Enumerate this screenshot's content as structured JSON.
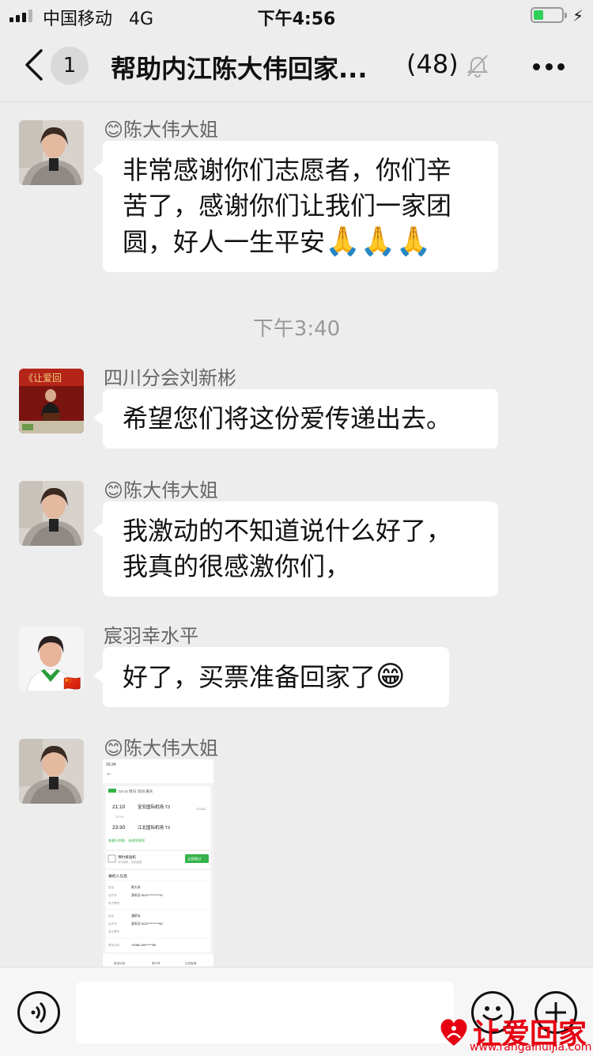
{
  "status_bar": {
    "carrier": "中国移动",
    "network": "4G",
    "time": "下午4:56",
    "battery_level": 0.35
  },
  "nav": {
    "unread_count": "1",
    "title": "帮助内江陈大伟回家...",
    "member_count": "(48)"
  },
  "messages": [
    {
      "sender_emoji": "😊",
      "sender": "陈大伟大姐",
      "lines": [
        "非常感谢你们志愿者，你们辛",
        "苦了，感谢你们让我们一家团",
        "圆，好人一生平安"
      ],
      "emojis": "🙏🙏🙏"
    },
    {
      "sender": "四川分会刘新彬",
      "lines": [
        "希望您们将这份爱传递出去。"
      ]
    },
    {
      "sender_emoji": "😊",
      "sender": "陈大伟大姐",
      "lines": [
        "我激动的不知道说什么好了，",
        "我真的很感激你们，"
      ]
    },
    {
      "sender": "宸羽幸水平",
      "lines": [
        "好了，买票准备回家了"
      ],
      "emojis": "😁"
    },
    {
      "sender_emoji": "😊",
      "sender": "陈大伟大姐"
    }
  ],
  "timestamp": "下午3:40",
  "ticket_image": {
    "status_time": "16:34",
    "date_route": "03-15 周日 深圳-重庆",
    "depart_time": "21:10",
    "depart_airport": "宝安国际机场 T3",
    "duration": "2h20m",
    "arrive_time": "23:30",
    "arrive_airport": "江北国际机场 T3",
    "flight_no": "CZ3314",
    "link": "查看行李额、退改签规则",
    "pickup_title": "预约接送机",
    "pickup_sub": "专车接机，送机免费",
    "pickup_button": "立即预订",
    "section": "乘机人信息",
    "p1_name_label": "姓名",
    "p1_name": "陈大伟",
    "p1_id_label": "证件号",
    "p1_id": "身份证 5110**********10",
    "p1_ticket_label": "电子票号",
    "p2_name_label": "姓名",
    "p2_name": "潘娇仙",
    "p2_id_label": "证件号",
    "p2_id": "身份证 5110**********60",
    "p2_ticket_label": "电子票号",
    "phone_label": "联系手机",
    "phone": "+0086 150******56",
    "tab1": "航班动态",
    "tab2": "邮行李",
    "tab3": "在线客服"
  },
  "watermark": {
    "text": "让爱回家",
    "url": "www.rangaihuijia.com"
  },
  "colors": {
    "background": "#ededed",
    "bubble": "#ffffff",
    "battery": "#2fd158",
    "watermark": "#e60012",
    "accent_green": "#35b34a"
  },
  "icons": [
    "back-icon",
    "mute-bell-icon",
    "more-icon",
    "voice-icon",
    "emoji-icon",
    "plus-icon"
  ]
}
